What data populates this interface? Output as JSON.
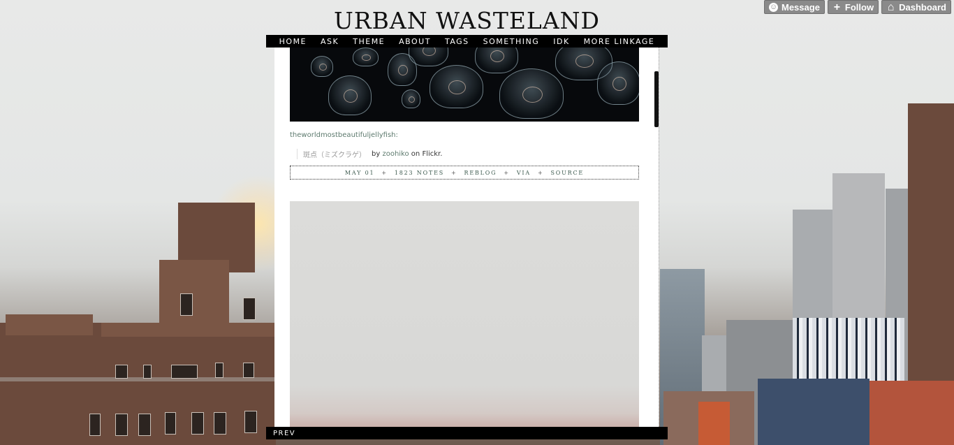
{
  "blog": {
    "title": "URBAN WASTELAND"
  },
  "controls": [
    {
      "label": "Message",
      "icon": "smiley-icon"
    },
    {
      "label": "Follow",
      "icon": "plus-icon"
    },
    {
      "label": "Dashboard",
      "icon": "home-icon"
    }
  ],
  "nav": {
    "items": [
      "HOME",
      "ASK",
      "THEME",
      "ABOUT",
      "TAGS",
      "SOMETHING",
      "IDK",
      "MORE LINKAGE"
    ]
  },
  "post1": {
    "source_user": "theworldmostbeautifuljellyfish:",
    "quote_text": "斑点（ミズクラゲ）",
    "by": "by",
    "author": "zoohiko",
    "on": "on",
    "platform": "Flickr.",
    "meta": {
      "date": "MAY 01",
      "notes": "1823 NOTES",
      "reblog": "REBLOG",
      "via": "VIA",
      "source": "SOURCE",
      "separator": "+"
    }
  },
  "pagination": {
    "prev": "PREV"
  },
  "colors": {
    "nav_bg": "#000000",
    "link_green": "#5d7a6e",
    "control_grey": "#8a8a8a"
  }
}
